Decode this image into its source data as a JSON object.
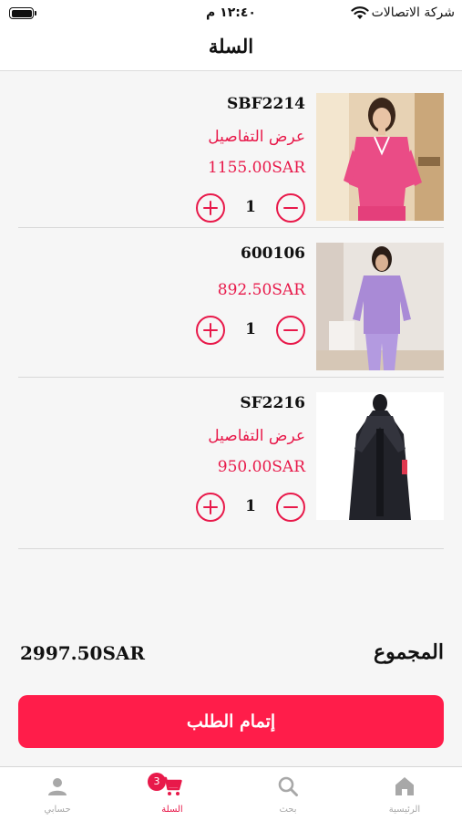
{
  "status_bar": {
    "time": "١٢:٤٠ م",
    "carrier": "شركة الاتصالات"
  },
  "navbar": {
    "title": "السلة"
  },
  "cart": {
    "items": [
      {
        "code": "SBF2214",
        "details_label": "عرض التفاصيل",
        "price": "1155.00SAR",
        "quantity": "1",
        "image": "pink-blazer-outfit"
      },
      {
        "code": "600106",
        "details_label": "",
        "price": "892.50SAR",
        "quantity": "1",
        "image": "lilac-loungewear-set"
      },
      {
        "code": "SF2216",
        "details_label": "عرض التفاصيل",
        "price": "950.00SAR",
        "quantity": "1",
        "image": "black-abaya"
      }
    ]
  },
  "summary": {
    "total_label": "المجموع",
    "total_value": "2997.50SAR",
    "checkout_label": "إتمام الطلب"
  },
  "tabbar": {
    "tabs": [
      {
        "label": "الرئيسية",
        "icon": "home-icon"
      },
      {
        "label": "بحث",
        "icon": "search-icon"
      },
      {
        "label": "السلة",
        "icon": "cart-icon",
        "badge": "3"
      },
      {
        "label": "حسابي",
        "icon": "person-icon"
      }
    ]
  },
  "colors": {
    "accent": "#e8194a",
    "checkout_button": "#ff1d4a",
    "inactive_tab": "#a8a8a8"
  }
}
